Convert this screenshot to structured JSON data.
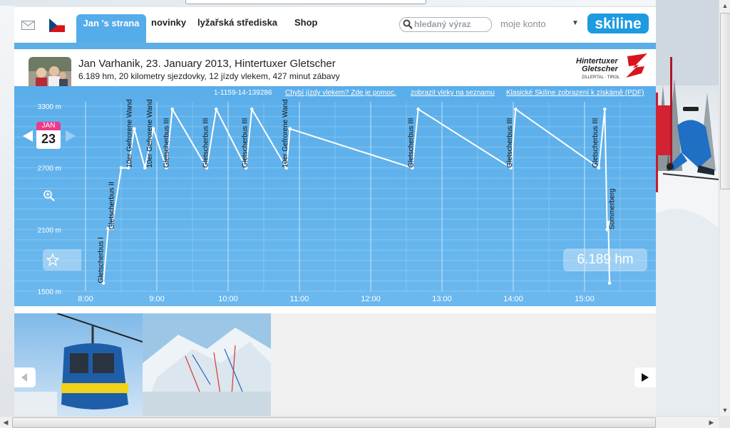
{
  "nav": {
    "tabs": [
      {
        "label": "Jan 's strana",
        "active": true
      },
      {
        "label": "novinky"
      },
      {
        "label": "lyžařská střediska"
      },
      {
        "label": "Shop"
      }
    ],
    "search_placeholder": "hledaný výraz",
    "account_label": "moje konto",
    "logo_text": "skiline",
    "icons": [
      "mail-icon",
      "czech-flag-icon",
      "search-icon",
      "dropdown-arrow-icon"
    ]
  },
  "header": {
    "title": "Jan Varhanik, 23. January 2013, Hintertuxer Gletscher",
    "subtitle": "6.189 hm, 20 kilometry sjezdovky, 12 jízdy vlekem, 427 minut zábavy",
    "resort_logo": {
      "line1": "Hintertuxer",
      "line2": "Gletscher",
      "line3": "ZILLERTAL · TIROL"
    }
  },
  "chart_links": {
    "id": "1-1159-14-139286",
    "missing_lifts": "Chybí jízdy vlekem? Zde je pomoc.",
    "show_lifts": "zobrazit vleky na seznamu",
    "classic": "Klasické Skiline zobrazení k získámě (PDF)"
  },
  "date": {
    "month": "JAN",
    "day": "23"
  },
  "total_label": "6.189 hm",
  "chart_data": {
    "type": "line",
    "title": "",
    "xlabel": "",
    "ylabel": "",
    "y_ticks": [
      "3300 m",
      "2700 m",
      "2100 m",
      "1500 m"
    ],
    "y_tick_values": [
      3300,
      2700,
      2100,
      1500
    ],
    "x_ticks": [
      "8:00",
      "9:00",
      "10:00",
      "11:00",
      "12:00",
      "13:00",
      "14:00",
      "15:00"
    ],
    "x_tick_values": [
      "8:00",
      "9:00",
      "10:00",
      "11:00",
      "12:00",
      "13:00",
      "14:00",
      "15:00"
    ],
    "ylim": [
      1500,
      3300
    ],
    "xlim": [
      "8:00",
      "16:00"
    ],
    "grid": true,
    "series": [
      {
        "values": [
          [
            "8:15",
            1580
          ],
          [
            "8:19",
            2110
          ],
          [
            "8:22",
            2110
          ],
          [
            "8:30",
            2700
          ],
          [
            "8:36",
            2700
          ],
          [
            "8:41",
            3080
          ],
          [
            "8:50",
            2700
          ],
          [
            "8:57",
            3080
          ],
          [
            "9:08",
            2700
          ],
          [
            "9:13",
            3270
          ],
          [
            "9:42",
            2700
          ],
          [
            "9:50",
            3270
          ],
          [
            "10:15",
            2700
          ],
          [
            "10:20",
            3270
          ],
          [
            "10:49",
            2700
          ],
          [
            "10:52",
            3080
          ],
          [
            "12:35",
            2700
          ],
          [
            "12:40",
            3270
          ],
          [
            "13:58",
            2700
          ],
          [
            "14:02",
            3270
          ],
          [
            "15:12",
            2700
          ],
          [
            "15:17",
            3270
          ],
          [
            "15:19",
            2100
          ],
          [
            "15:20",
            2170
          ],
          [
            "15:21",
            1580
          ]
        ]
      }
    ],
    "lift_labels": [
      {
        "time": "8:13",
        "name": "Gletscherbus I"
      },
      {
        "time": "8:22",
        "name": "Gletscherbus II"
      },
      {
        "time": "8:37",
        "name": "10er Gefrorene Wand"
      },
      {
        "time": "8:54",
        "name": "10er Gefrorene Wand"
      },
      {
        "time": "9:08",
        "name": "Gletscherbus III"
      },
      {
        "time": "9:41",
        "name": "Gletscherbus III"
      },
      {
        "time": "10:14",
        "name": "Gletscherbus III"
      },
      {
        "time": "10:48",
        "name": "10er Gefrorene Wand"
      },
      {
        "time": "12:34",
        "name": "Gletscherbus III"
      },
      {
        "time": "13:57",
        "name": "Gletscherbus III"
      },
      {
        "time": "15:09",
        "name": "Gletscherbus III"
      },
      {
        "time": "15:23",
        "name": "Sommerberg"
      }
    ]
  },
  "gallery": {
    "items": [
      "gondola-photo",
      "piste-map"
    ]
  }
}
